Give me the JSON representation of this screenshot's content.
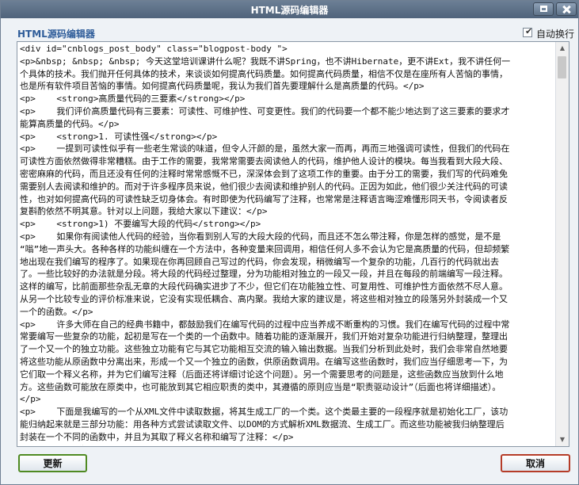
{
  "window": {
    "title": "HTML源码编辑器"
  },
  "panel": {
    "title": "HTML源码编辑器",
    "wrap_label": "自动换行",
    "wrap_checked": true
  },
  "editor": {
    "lines": [
      "<div id=\"cnblogs_post_body\" class=\"blogpost-body \">",
      "<p>&nbsp; &nbsp; &nbsp; 今天这堂培训课讲什么呢？我既不讲Spring，也不讲Hibernate，更不讲Ext，我不讲任何一",
      "个具体的技术。我们抛开任何具体的技术，来谈谈如何提高代码质量。如何提高代码质量，相信不仅是在座所有人苦恼的事情，",
      "也是所有软件项目苦恼的事情。如何提高代码质量呢，我认为我们首先要理解什么是高质量的代码。</p>",
      "<p>    <strong>高质量代码的三要素</strong></p>",
      "<p>    我们评价高质量代码有三要素：可读性、可维护性、可变更性。我们的代码要一个都不能少地达到了这三要素的要求才",
      "能算高质量的代码。</p>",
      "<p>    <strong>1. 可读性强</strong></p>",
      "<p>    一提到可读性似乎有一些老生常谈的味道，但令人汗颜的是，虽然大家一而再，再而三地强调可读性，但我们的代码在",
      "可读性方面依然做得非常糟糕。由于工作的需要，我常常需要去阅读他人的代码，维护他人设计的模块。每当我看到大段大段、",
      "密密麻麻的代码，而且还没有任何的注释时常常感慨不已，深深体会到了这项工作的重要。由于分工的需要，我们写的代码难免",
      "需要别人去阅读和维护的。而对于许多程序员来说，他们很少去阅读和维护别人的代码。正因为如此，他们很少关注代码的可读",
      "性，也对如何提高代码的可读性缺乏切身体会。有时即使为代码编写了注释，也常常是注释语言晦涩难懂形同天书，令阅读者反",
      "复斟酌依然不明其意。针对以上问题，我给大家以下建议：</p>",
      "<p>    <strong>1) 不要编写大段的代码</strong></p>",
      "<p>    如果你有阅读他人代码的经验，当你看到别人写的大段大段的代码，而且还不怎么带注释，你是怎样的感觉，是不是",
      "“嗡”地一声头大。各种各样的功能纠缠在一个方法中，各种变量来回调用，相信任何人多不会认为它是高质量的代码，但却频繁",
      "地出现在我们编写的程序了。如果现在你再回顾自己写过的代码，你会发现，稍微编写一个复杂的功能，几百行的代码就出去",
      "了。一些比较好的办法就是分段。将大段的代码经过整理，分为功能相对独立的一段又一段，并且在每段的前端编写一段注释。",
      "这样的编写，比前面那些杂乱无章的大段代码确实进步了不少，但它们在功能独立性、可复用性、可维护性方面依然不尽人意。",
      "从另一个比较专业的评价标准来说，它没有实现低耦合、高内聚。我给大家的建议是，将这些相对独立的段落另外封装成一个又",
      "一个的函数。</p>",
      "<p>    许多大师在自己的经典书籍中，都鼓励我们在编写代码的过程中应当养成不断重构的习惯。我们在编写代码的过程中常",
      "常要编写一些复杂的功能，起初是写在一个类的一个函数中。随着功能的逐渐展开，我们开始对复杂功能进行归纳整理，整理出",
      "了一个又一个的独立功能。这些独立功能有它与其它功能相互交流的输入输出数据。当我们分析到此处时，我们会非常自然地要",
      "将这些功能从原函数中分离出来，形成一个又一个独立的函数，供原函数调用。在编写这些函数时，我们应当仔细思考一下，为",
      "它们取一个释义名称，并为它们编写注释（后面还将详细讨论这个问题）。另一个需要思考的问题是，这些函数应当放到什么地",
      "方。这些函数可能放在原类中，也可能放到其它相应职责的类中，其遵循的原则应当是“职责驱动设计”（后面也将详细描述）。",
      "</p>",
      "<p>    下面是我编写的一个从XML文件中读取数据，将其生成工厂的一个类。这个类最主要的一段程序就是初始化工厂，该功",
      "能归纳起来就是三部分功能：用各种方式尝试读取文件、以DOM的方式解析XML数据流、生成工厂。而这些功能被我归纳整理后",
      "封装在一个不同的函数中，并且为其取了释义名称和编写了注释：</p>",
      "<p>    Java代码</p>",
      "<div class=\"cnblogs_code\"><div class=\"cnblogs_code_toolbar\"><span class=\"cnblogs_code_copy\"><a"
    ]
  },
  "buttons": {
    "update": "更新",
    "cancel": "取消"
  },
  "colors": {
    "title_bar": "#5a6e86",
    "panel_title": "#2f5d9a",
    "update_border": "#4f8a22",
    "cancel_border": "#b53c28"
  }
}
